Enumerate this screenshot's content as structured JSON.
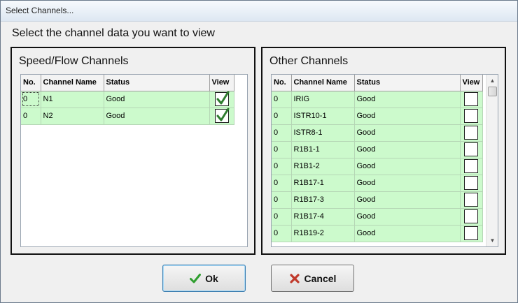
{
  "window": {
    "title": "Select Channels..."
  },
  "heading": "Select the channel data you want to view",
  "speed_flow": {
    "title": "Speed/Flow Channels",
    "columns": [
      "No.",
      "Channel Name",
      "Status",
      "View"
    ],
    "rows": [
      {
        "no": "0",
        "name": "N1",
        "status": "Good",
        "checked": true
      },
      {
        "no": "0",
        "name": "N2",
        "status": "Good",
        "checked": true
      }
    ]
  },
  "other": {
    "title": "Other Channels",
    "columns": [
      "No.",
      "Channel Name",
      "Status",
      "View"
    ],
    "rows": [
      {
        "no": "0",
        "name": "IRIG",
        "status": "Good",
        "checked": false
      },
      {
        "no": "0",
        "name": "ISTR10-1",
        "status": "Good",
        "checked": false
      },
      {
        "no": "0",
        "name": "ISTR8-1",
        "status": "Good",
        "checked": false
      },
      {
        "no": "0",
        "name": "R1B1-1",
        "status": "Good",
        "checked": false
      },
      {
        "no": "0",
        "name": "R1B1-2",
        "status": "Good",
        "checked": false
      },
      {
        "no": "0",
        "name": "R1B17-1",
        "status": "Good",
        "checked": false
      },
      {
        "no": "0",
        "name": "R1B17-3",
        "status": "Good",
        "checked": false
      },
      {
        "no": "0",
        "name": "R1B17-4",
        "status": "Good",
        "checked": false
      },
      {
        "no": "0",
        "name": "R1B19-2",
        "status": "Good",
        "checked": false
      }
    ]
  },
  "buttons": {
    "ok": "Ok",
    "cancel": "Cancel"
  },
  "icons": {
    "ok": "checkmark-icon",
    "cancel": "x-icon"
  },
  "colors": {
    "row_bg": "#ccfacc",
    "ok_green": "#2e9e2e",
    "cancel_red": "#c0392b"
  }
}
